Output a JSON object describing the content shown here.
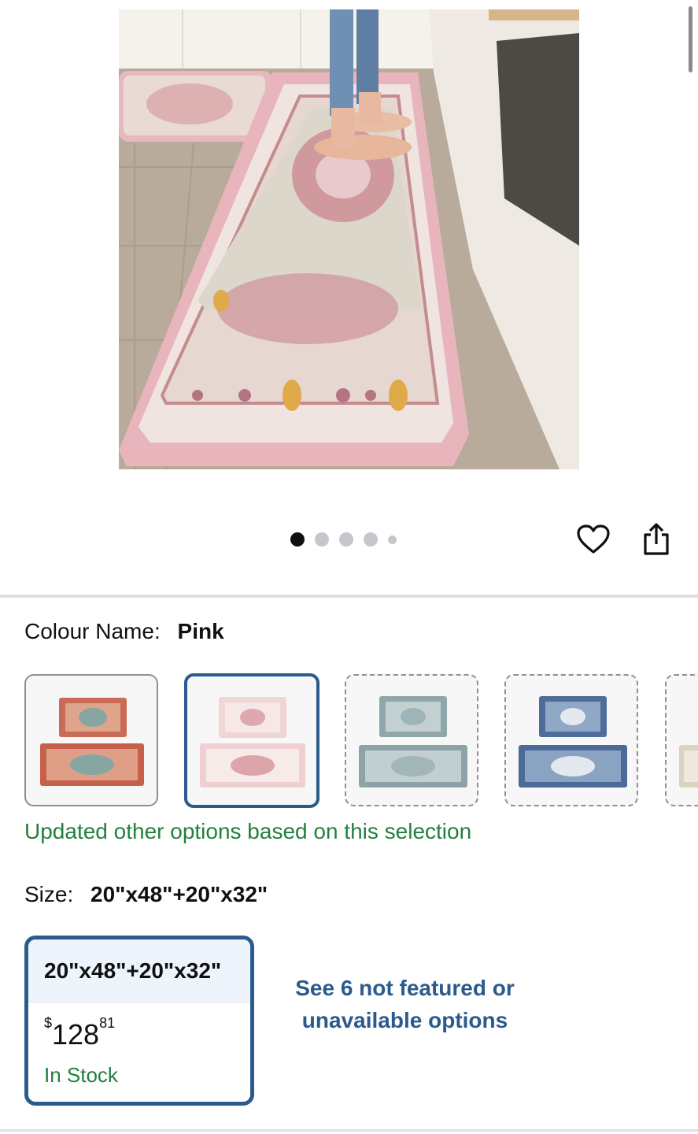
{
  "product_image": {
    "alt_icon": "rug-photo"
  },
  "carousel": {
    "count": 5,
    "active_index": 0
  },
  "actions": {
    "favourite_icon": "heart-icon",
    "share_icon": "share-icon"
  },
  "colour": {
    "label": "Colour Name:",
    "value": "Pink",
    "swatches": [
      {
        "name": "red",
        "color": "#c96b55",
        "selected": false,
        "available": true
      },
      {
        "name": "pink",
        "color": "#f0d4d6",
        "selected": true,
        "available": true
      },
      {
        "name": "teal",
        "color": "#a9bfc4",
        "selected": false,
        "available": false
      },
      {
        "name": "blue",
        "color": "#5c7aa8",
        "selected": false,
        "available": false
      },
      {
        "name": "beige",
        "color": "#e4ddd0",
        "selected": false,
        "available": false
      }
    ],
    "updated_message": "Updated other options based on this selection"
  },
  "size": {
    "label": "Size:",
    "value": "20\"x48\"+20\"x32\"",
    "option": {
      "title": "20\"x48\"+20\"x32\"",
      "currency": "$",
      "price_whole": "128",
      "price_fraction": "81",
      "availability": "In Stock"
    },
    "see_more": "See 6 not featured or unavailable options"
  }
}
